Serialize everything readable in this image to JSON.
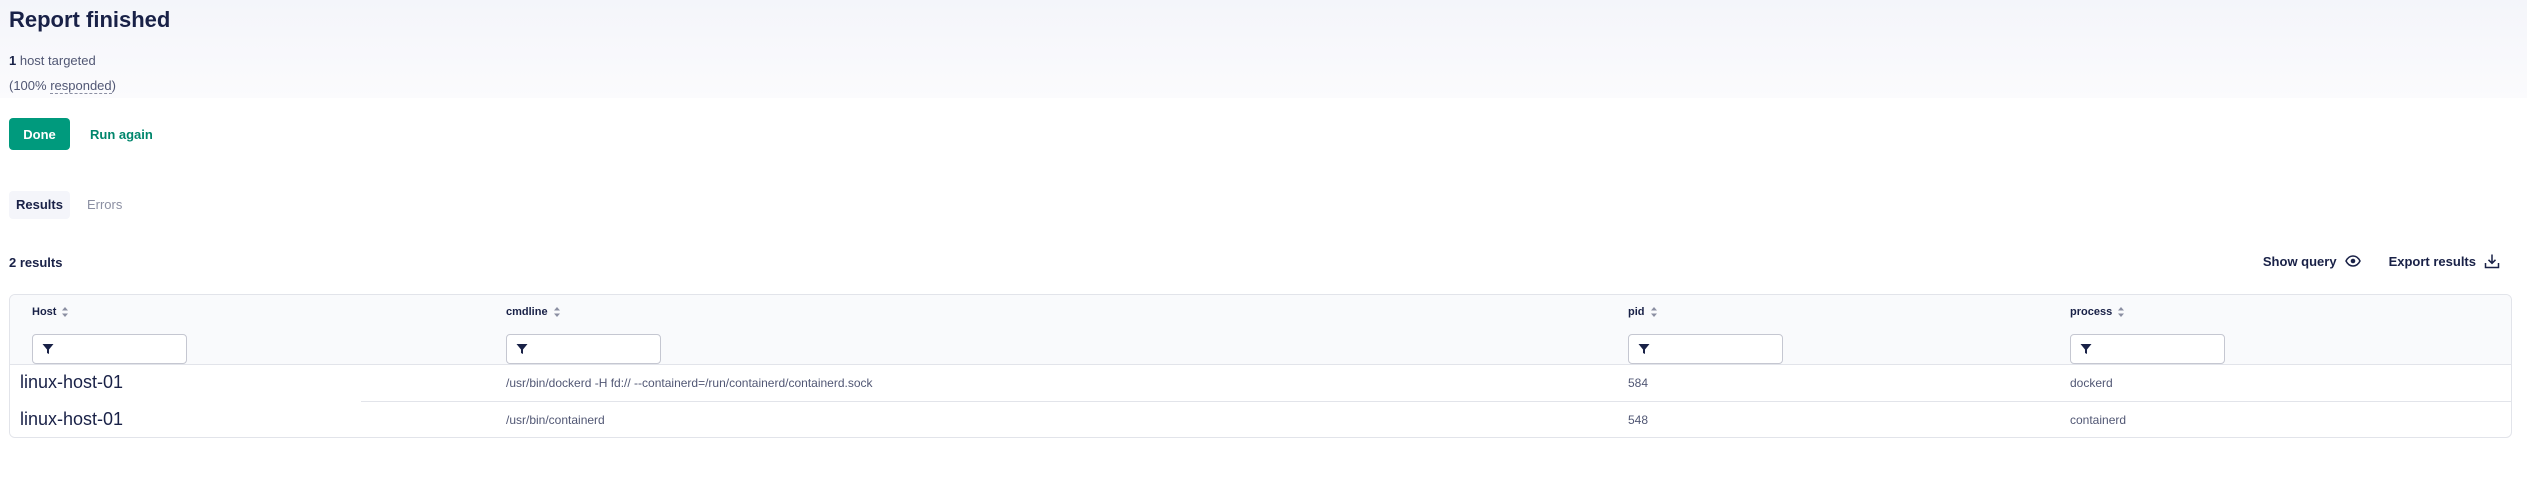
{
  "page": {
    "title": "Report finished",
    "targeted_count": "1",
    "targeted_label": " host targeted",
    "responded": {
      "open": "(100% ",
      "word": "responded",
      "close": ")"
    }
  },
  "actions": {
    "done_label": "Done",
    "run_again_label": "Run again"
  },
  "tabs": [
    {
      "label": "Results",
      "active": true
    },
    {
      "label": "Errors",
      "active": false
    }
  ],
  "results": {
    "count_label": "2 results",
    "show_query_label": "Show query",
    "export_label": "Export results"
  },
  "table": {
    "columns": [
      {
        "key": "host",
        "label": "Host",
        "filter_value": ""
      },
      {
        "key": "cmdline",
        "label": "cmdline",
        "filter_value": ""
      },
      {
        "key": "pid",
        "label": "pid",
        "filter_value": ""
      },
      {
        "key": "process",
        "label": "process",
        "filter_value": ""
      }
    ],
    "rows": [
      {
        "host": "linux-host-01",
        "cmdline": "/usr/bin/dockerd -H fd:// --containerd=/run/containerd/containerd.sock",
        "pid": "584",
        "process": "dockerd"
      },
      {
        "host": "linux-host-01",
        "cmdline": "/usr/bin/containerd",
        "pid": "548",
        "process": "containerd"
      }
    ]
  },
  "colors": {
    "accent": "#009a7d",
    "accent_text": "#00866c",
    "text_primary": "#192147",
    "text_secondary": "#515774",
    "border": "#e2e4ea"
  },
  "icons": {
    "show_query": "eye-icon",
    "export": "download-icon",
    "sort": "sort-icon",
    "filter": "filter-icon"
  }
}
